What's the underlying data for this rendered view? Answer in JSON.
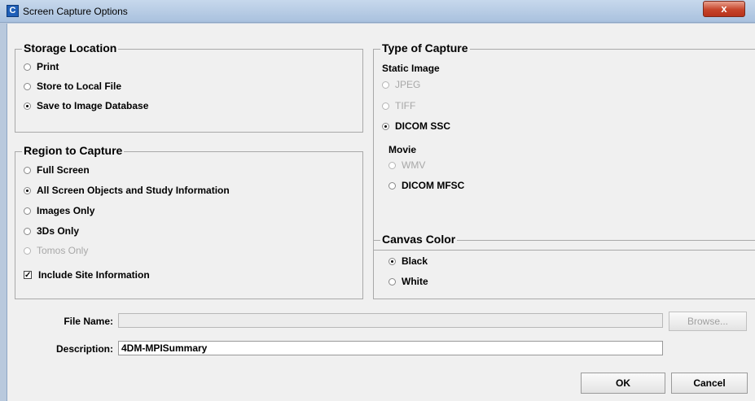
{
  "window": {
    "title": "Screen Capture Options",
    "close_glyph": "x",
    "app_icon_glyph": "C"
  },
  "storage": {
    "title": "Storage Location",
    "options": [
      "Print",
      "Store to Local File",
      "Save to Image Database"
    ],
    "selected": "Save to Image Database"
  },
  "region": {
    "title": "Region to Capture",
    "options": [
      "Full Screen",
      "All Screen Objects and Study Information",
      "Images Only",
      "3Ds Only",
      "Tomos Only"
    ],
    "selected": "All Screen Objects and Study Information",
    "disabled": [
      "Tomos Only"
    ],
    "include_site_label": "Include Site Information",
    "include_site_checked": true
  },
  "capture": {
    "title": "Type of Capture",
    "static_label": "Static Image",
    "static_options": [
      "JPEG",
      "TIFF",
      "DICOM SSC"
    ],
    "movie_label": "Movie",
    "movie_options": [
      "WMV",
      "DICOM MFSC"
    ],
    "selected": [
      "DICOM SSC"
    ],
    "disabled": [
      "JPEG",
      "TIFF",
      "WMV"
    ]
  },
  "canvas": {
    "title": "Canvas Color",
    "options": [
      "Black",
      "White"
    ],
    "selected": "Black"
  },
  "form": {
    "file_name_label": "File Name:",
    "file_name_value": "",
    "description_label": "Description:",
    "description_value": "4DM-MPISummary",
    "browse_label": "Browse...",
    "check_glyph": "✓"
  },
  "buttons": {
    "ok": "OK",
    "cancel": "Cancel"
  }
}
